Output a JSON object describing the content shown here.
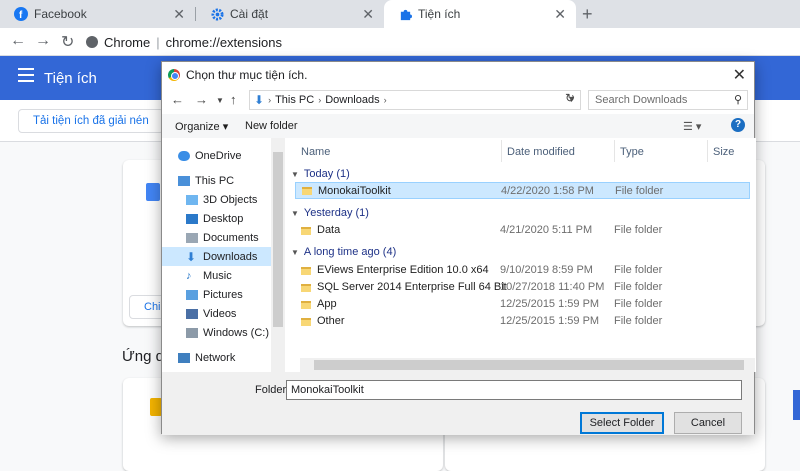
{
  "browser": {
    "tabs": [
      {
        "label": "Facebook",
        "icon": "facebook-icon",
        "color": "#1877f2"
      },
      {
        "label": "Cài đặt",
        "icon": "gear-icon",
        "color": "#1a73e8"
      },
      {
        "label": "Tiện ích",
        "icon": "puzzle-icon",
        "color": "#1a73e8"
      }
    ],
    "url_scheme": "Chrome",
    "url_path": "chrome://extensions"
  },
  "extensions_page": {
    "title": "Tiện ích",
    "load_unpacked": "Tải tiện ích đã giải nén",
    "card_button": "Chi",
    "apps_label": "Ứng dụ"
  },
  "dialog": {
    "title": "Chọn thư mục tiện ích.",
    "path": [
      "This PC",
      "Downloads"
    ],
    "search_placeholder": "Search Downloads",
    "organize": "Organize",
    "new_folder": "New folder",
    "nav_items": [
      {
        "label": "OneDrive",
        "icon": "cloud-icon"
      },
      {
        "label": "This PC",
        "icon": "computer-icon"
      },
      {
        "label": "3D Objects",
        "icon": "cube-icon"
      },
      {
        "label": "Desktop",
        "icon": "desktop-icon"
      },
      {
        "label": "Documents",
        "icon": "document-icon"
      },
      {
        "label": "Downloads",
        "icon": "download-icon"
      },
      {
        "label": "Music",
        "icon": "music-icon"
      },
      {
        "label": "Pictures",
        "icon": "picture-icon"
      },
      {
        "label": "Videos",
        "icon": "video-icon"
      },
      {
        "label": "Windows (C:)",
        "icon": "drive-icon"
      },
      {
        "label": "Network",
        "icon": "network-icon"
      }
    ],
    "columns": {
      "name": "Name",
      "date": "Date modified",
      "type": "Type",
      "size": "Size"
    },
    "groups": [
      {
        "label": "Today (1)",
        "rows": [
          {
            "name": "MonokaiToolkit",
            "date": "4/22/2020 1:58 PM",
            "type": "File folder",
            "selected": true
          }
        ]
      },
      {
        "label": "Yesterday (1)",
        "rows": [
          {
            "name": "Data",
            "date": "4/21/2020 5:11 PM",
            "type": "File folder"
          }
        ]
      },
      {
        "label": "A long time ago (4)",
        "rows": [
          {
            "name": "EViews Enterprise Edition 10.0 x64",
            "date": "9/10/2019 8:59 PM",
            "type": "File folder"
          },
          {
            "name": "SQL Server 2014 Enterprise Full 64 Bit",
            "date": "10/27/2018 11:40 PM",
            "type": "File folder"
          },
          {
            "name": "App",
            "date": "12/25/2015 1:59 PM",
            "type": "File folder"
          },
          {
            "name": "Other",
            "date": "12/25/2015 1:59 PM",
            "type": "File folder"
          }
        ]
      }
    ],
    "folder_label": "Folder:",
    "folder_value": "MonokaiToolkit",
    "select_button": "Select Folder",
    "cancel_button": "Cancel"
  }
}
